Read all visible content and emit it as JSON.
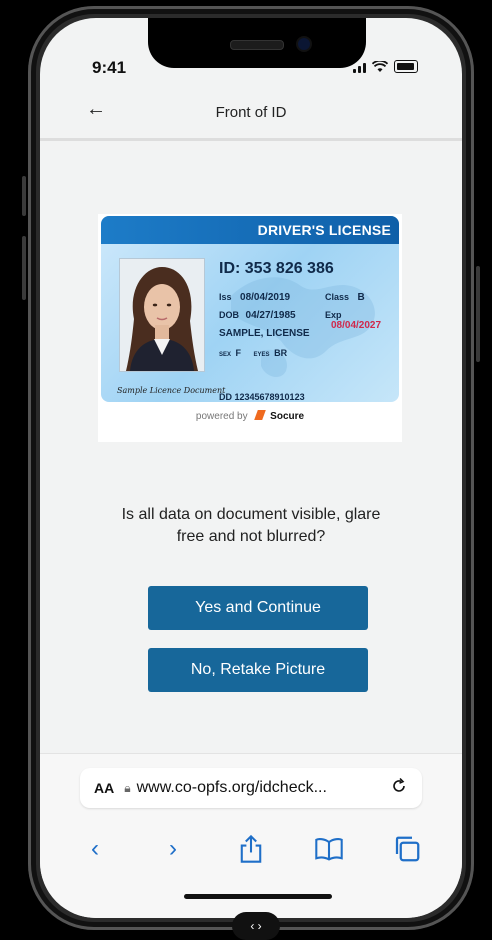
{
  "status_bar": {
    "time": "9:41"
  },
  "nav": {
    "back_label": "←",
    "title": "Front of ID"
  },
  "id_card": {
    "header": "DRIVER'S LICENSE",
    "id_text": "ID: 353 826 386",
    "iss_label": "Iss",
    "iss": "08/04/2019",
    "class_label": "Class",
    "class": "B",
    "dob_label": "DOB",
    "dob": "04/27/1985",
    "exp_label": "Exp",
    "exp": "08/04/2027",
    "name": "SAMPLE, LICENSE",
    "sex_label": "SEX",
    "sex": "F",
    "eyes_label": "EYES",
    "eyes": "BR",
    "dd": "DD 12345678910123",
    "signature": "Sample Licence Document",
    "powered_by": "powered by",
    "brand": "Socure"
  },
  "prompt": {
    "question": "Is all data on document visible, glare free and not blurred?"
  },
  "buttons": {
    "yes": "Yes and Continue",
    "no": "No, Retake Picture"
  },
  "browser": {
    "aa": "AA",
    "url": "www.co-opfs.org/idcheck...",
    "reload_icon": "reload-icon"
  },
  "toolbar": {
    "back": "‹",
    "forward": "›"
  },
  "handle": "‹ ›",
  "colors": {
    "button": "#17679a",
    "link_blue": "#1f6fc8",
    "card_header": "#1d7cc8",
    "exp_red": "#d0284b"
  }
}
